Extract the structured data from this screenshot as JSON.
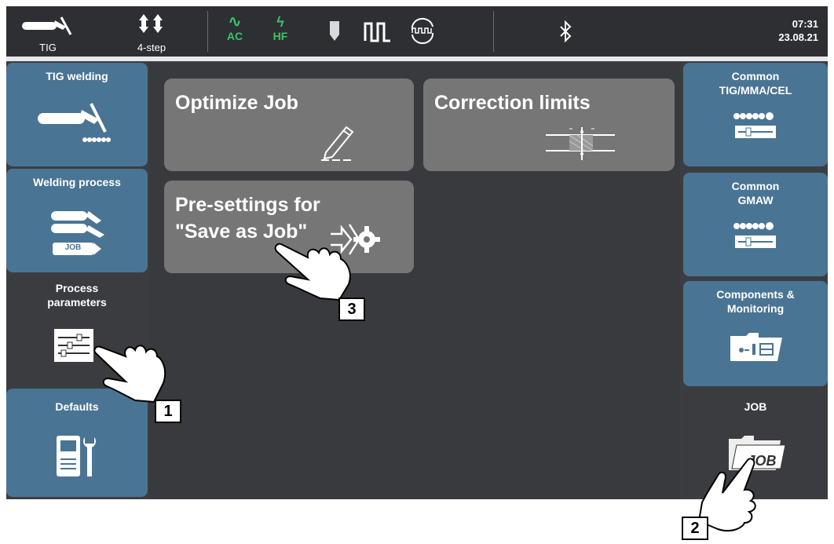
{
  "topbar": {
    "process": "TIG",
    "mode": "4-step",
    "ac": "AC",
    "hf": "HF",
    "time": "07:31",
    "date": "23.08.21",
    "icons": [
      "tig-torch-icon",
      "four-step-icon",
      "ac-wave-icon",
      "hf-icon",
      "electrode-icon",
      "pulse-icon",
      "cycle-icon",
      "bluetooth-icon"
    ],
    "accent_green": "#38c468"
  },
  "left_tiles": [
    {
      "label": "TIG welding",
      "state": "blue"
    },
    {
      "label": "Welding process",
      "state": "blue"
    },
    {
      "label": "Process parameters",
      "label_lines": [
        "Process",
        "parameters"
      ],
      "state": "active"
    },
    {
      "label": "Defaults",
      "state": "blue"
    }
  ],
  "left_tiles_job_badge": "JOB",
  "right_tiles": [
    {
      "label_lines": [
        "Common",
        "TIG/MMA/CEL"
      ],
      "state": "blue"
    },
    {
      "label_lines": [
        "Common",
        "GMAW"
      ],
      "state": "blue"
    },
    {
      "label_lines": [
        "Components &",
        "Monitoring"
      ],
      "state": "blue"
    },
    {
      "label": "JOB",
      "state": "active"
    }
  ],
  "right_job_icon_text": "JOB",
  "cards": [
    {
      "title": "Optimize Job",
      "icon": "pencil-icon"
    },
    {
      "title": "Correction limits",
      "icon": "limits-icon"
    },
    {
      "title_lines": [
        "Pre-settings for",
        "\"Save as Job\""
      ],
      "icon": "settings-arrow-icon"
    }
  ],
  "callouts": [
    "1",
    "2",
    "3"
  ],
  "colors": {
    "tile_blue": "#4a7494",
    "tile_dark": "#3a3c40",
    "card_gray": "#767676"
  }
}
